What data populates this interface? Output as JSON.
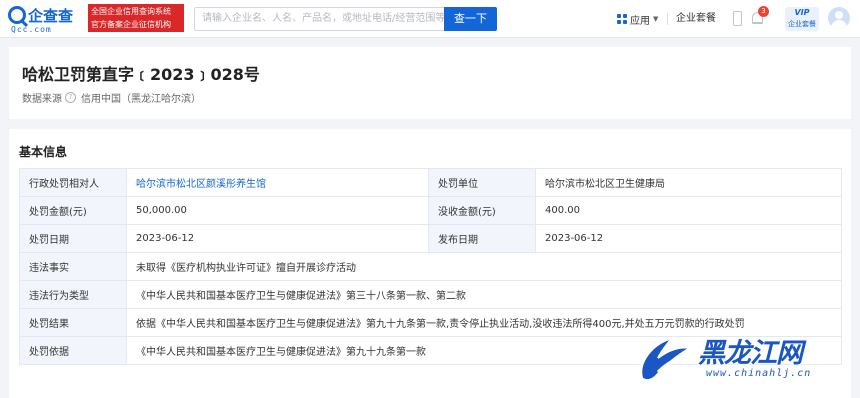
{
  "header": {
    "logo_text": "企查查",
    "logo_sub": "Qcc.com",
    "badge_line1": "全国企业信用查询系统",
    "badge_line2": "官方备案企业征信机构",
    "search_placeholder": "请输入企业名、人名、产品名，或地址电话/经营范围等",
    "search_button": "查一下",
    "app_label": "应用",
    "package_label": "企业套餐",
    "notification_count": "3",
    "vip_top": "VIP",
    "vip_bottom": "企业套餐"
  },
  "title_card": {
    "title": "哈松卫罚第直字﹝2023﹞028号",
    "source_label": "数据来源",
    "source_value": "信用中国（黑龙江哈尔滨）"
  },
  "basic_info": {
    "section_title": "基本信息",
    "row1": {
      "label_a": "行政处罚相对人",
      "value_a": "哈尔滨市松北区颜溪彤养生馆",
      "label_b": "处罚单位",
      "value_b": "哈尔滨市松北区卫生健康局"
    },
    "row2": {
      "label_a": "处罚金额(元)",
      "value_a": "50,000.00",
      "label_b": "没收金额(元)",
      "value_b": "400.00"
    },
    "row3": {
      "label_a": "处罚日期",
      "value_a": "2023-06-12",
      "label_b": "发布日期",
      "value_b": "2023-06-12"
    },
    "row4": {
      "label": "违法事实",
      "value": "未取得《医疗机构执业许可证》擅自开展诊疗活动"
    },
    "row5": {
      "label": "违法行为类型",
      "value": "《中华人民共和国基本医疗卫生与健康促进法》第三十八条第一款、第二款"
    },
    "row6": {
      "label": "处罚结果",
      "value": "依据《中华人民共和国基本医疗卫生与健康促进法》第九十九条第一款,责令停止执业活动,没收违法所得400元,并处五万元罚款的行政处罚"
    },
    "row7": {
      "label": "处罚依据",
      "value": "《中华人民共和国基本医疗卫生与健康促进法》第九十九条第一款"
    }
  },
  "watermark": {
    "text": "黑龙江网",
    "url": "www.chinahlj.cn"
  },
  "colors": {
    "brand": "#1366d7",
    "badge_red": "#d9272a",
    "label_bg": "#f2f6fc"
  }
}
